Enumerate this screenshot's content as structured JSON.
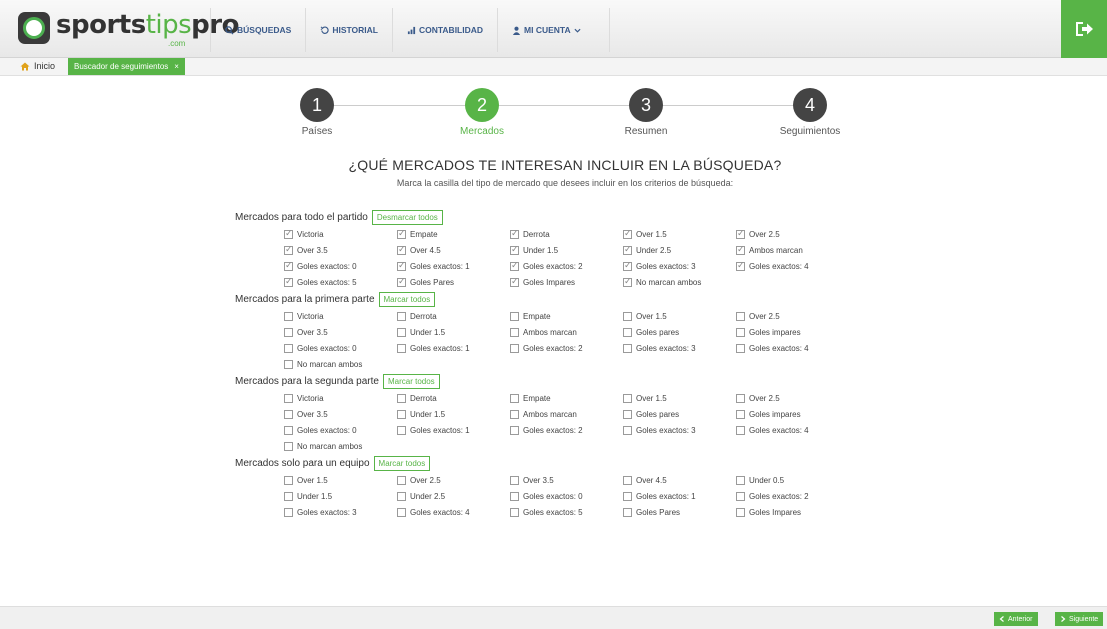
{
  "brand": {
    "name_a": "sports",
    "name_b": "tips",
    "name_c": "pro",
    "suffix": ".com",
    "accent": "#58b447"
  },
  "nav": [
    {
      "icon": "search-icon",
      "label": "BÚSQUEDAS"
    },
    {
      "icon": "history-icon",
      "label": "HISTORIAL"
    },
    {
      "icon": "chart-icon",
      "label": "CONTABILIDAD"
    },
    {
      "icon": "user-icon",
      "label": "MI CUENTA"
    }
  ],
  "breadcrumb": {
    "home": "Inicio",
    "tab": "Buscador de seguimientos",
    "tab_close": "×"
  },
  "steps": [
    {
      "number": "1",
      "label": "Países"
    },
    {
      "number": "2",
      "label": "Mercados"
    },
    {
      "number": "3",
      "label": "Resumen"
    },
    {
      "number": "4",
      "label": "Seguimientos"
    }
  ],
  "active_step": 2,
  "question": {
    "title": "¿QUÉ MERCADOS TE INTERESAN INCLUIR EN LA BÚSQUEDA?",
    "subtitle": "Marca la casilla del tipo de mercado que desees incluir en los criterios de búsqueda:"
  },
  "sections": [
    {
      "title": "Mercados para todo el partido",
      "button": "Desmarcar todos",
      "rows": [
        [
          {
            "label": "Victoria",
            "checked": true
          },
          {
            "label": "Empate",
            "checked": true
          },
          {
            "label": "Derrota",
            "checked": true
          },
          {
            "label": "Over 1.5",
            "checked": true
          },
          {
            "label": "Over 2.5",
            "checked": true
          }
        ],
        [
          {
            "label": "Over 3.5",
            "checked": true
          },
          {
            "label": "Over 4.5",
            "checked": true
          },
          {
            "label": "Under 1.5",
            "checked": true
          },
          {
            "label": "Under 2.5",
            "checked": true
          },
          {
            "label": "Ambos marcan",
            "checked": true
          }
        ],
        [
          {
            "label": "Goles exactos: 0",
            "checked": true
          },
          {
            "label": "Goles exactos: 1",
            "checked": true
          },
          {
            "label": "Goles exactos: 2",
            "checked": true
          },
          {
            "label": "Goles exactos: 3",
            "checked": true
          },
          {
            "label": "Goles exactos: 4",
            "checked": true
          }
        ],
        [
          {
            "label": "Goles exactos: 5",
            "checked": true
          },
          {
            "label": "Goles Pares",
            "checked": true
          },
          {
            "label": "Goles Impares",
            "checked": true
          },
          {
            "label": "No marcan ambos",
            "checked": true
          }
        ]
      ]
    },
    {
      "title": "Mercados para la primera parte",
      "button": "Marcar todos",
      "rows": [
        [
          {
            "label": "Victoria",
            "checked": false
          },
          {
            "label": "Derrota",
            "checked": false
          },
          {
            "label": "Empate",
            "checked": false
          },
          {
            "label": "Over 1.5",
            "checked": false
          },
          {
            "label": "Over 2.5",
            "checked": false
          }
        ],
        [
          {
            "label": "Over 3.5",
            "checked": false
          },
          {
            "label": "Under 1.5",
            "checked": false
          },
          {
            "label": "Ambos marcan",
            "checked": false
          },
          {
            "label": "Goles pares",
            "checked": false
          },
          {
            "label": "Goles impares",
            "checked": false
          }
        ],
        [
          {
            "label": "Goles exactos: 0",
            "checked": false
          },
          {
            "label": "Goles exactos: 1",
            "checked": false
          },
          {
            "label": "Goles exactos: 2",
            "checked": false
          },
          {
            "label": "Goles exactos: 3",
            "checked": false
          },
          {
            "label": "Goles exactos: 4",
            "checked": false
          }
        ],
        [
          {
            "label": "No marcan ambos",
            "checked": false
          }
        ]
      ]
    },
    {
      "title": "Mercados para la segunda parte",
      "button": "Marcar todos",
      "rows": [
        [
          {
            "label": "Victoria",
            "checked": false
          },
          {
            "label": "Derrota",
            "checked": false
          },
          {
            "label": "Empate",
            "checked": false
          },
          {
            "label": "Over 1.5",
            "checked": false
          },
          {
            "label": "Over 2.5",
            "checked": false
          }
        ],
        [
          {
            "label": "Over 3.5",
            "checked": false
          },
          {
            "label": "Under 1.5",
            "checked": false
          },
          {
            "label": "Ambos marcan",
            "checked": false
          },
          {
            "label": "Goles pares",
            "checked": false
          },
          {
            "label": "Goles impares",
            "checked": false
          }
        ],
        [
          {
            "label": "Goles exactos: 0",
            "checked": false
          },
          {
            "label": "Goles exactos: 1",
            "checked": false
          },
          {
            "label": "Goles exactos: 2",
            "checked": false
          },
          {
            "label": "Goles exactos: 3",
            "checked": false
          },
          {
            "label": "Goles exactos: 4",
            "checked": false
          }
        ],
        [
          {
            "label": "No marcan ambos",
            "checked": false
          }
        ]
      ]
    },
    {
      "title": "Mercados solo para un equipo",
      "button": "Marcar todos",
      "rows": [
        [
          {
            "label": "Over 1.5",
            "checked": false
          },
          {
            "label": "Over 2.5",
            "checked": false
          },
          {
            "label": "Over 3.5",
            "checked": false
          },
          {
            "label": "Over 4.5",
            "checked": false
          },
          {
            "label": "Under 0.5",
            "checked": false
          }
        ],
        [
          {
            "label": "Under 1.5",
            "checked": false
          },
          {
            "label": "Under 2.5",
            "checked": false
          },
          {
            "label": "Goles exactos: 0",
            "checked": false
          },
          {
            "label": "Goles exactos: 1",
            "checked": false
          },
          {
            "label": "Goles exactos: 2",
            "checked": false
          }
        ],
        [
          {
            "label": "Goles exactos: 3",
            "checked": false
          },
          {
            "label": "Goles exactos: 4",
            "checked": false
          },
          {
            "label": "Goles exactos: 5",
            "checked": false
          },
          {
            "label": "Goles Pares",
            "checked": false
          },
          {
            "label": "Goles Impares",
            "checked": false
          }
        ]
      ]
    }
  ],
  "footer": {
    "prev": "Anterior",
    "next": "Siguiente"
  }
}
